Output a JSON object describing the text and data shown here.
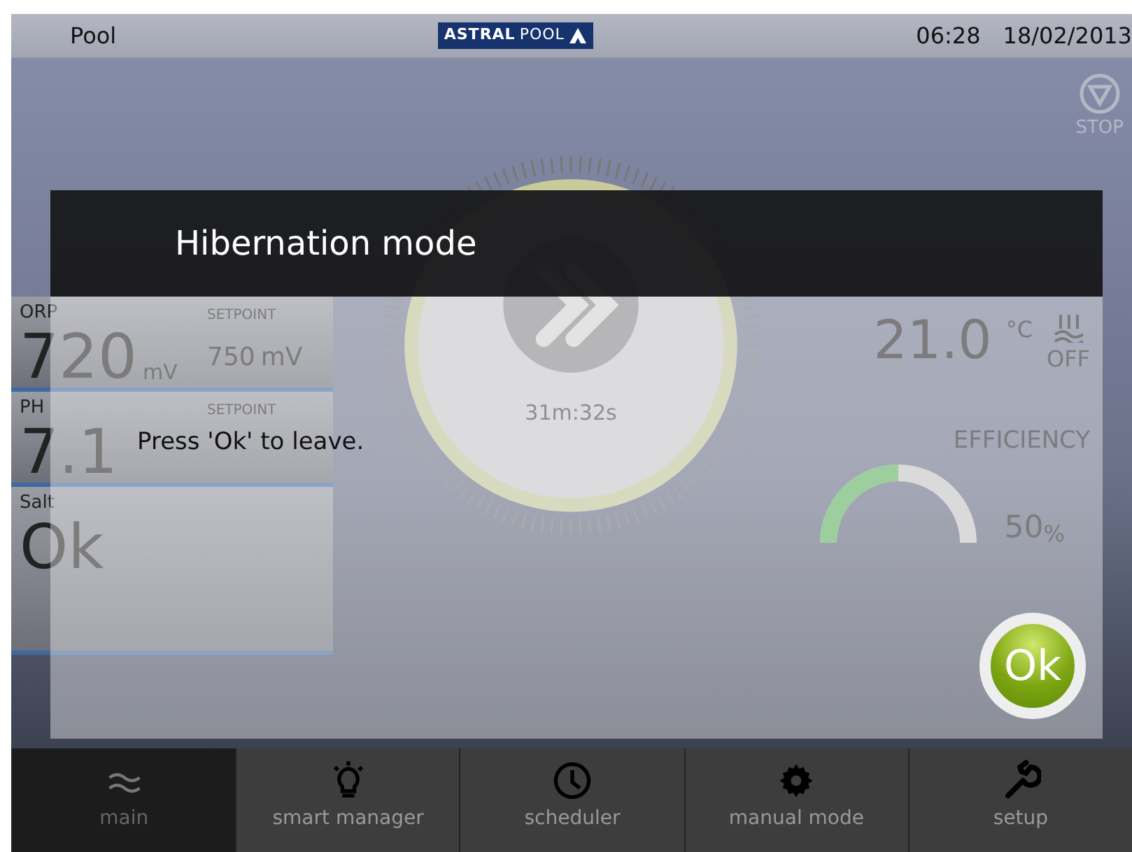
{
  "status_bar": {
    "title": "Pool",
    "logo": {
      "bold": "ASTRAL",
      "light": "POOL"
    },
    "time": "06:28",
    "date": "18/02/2013"
  },
  "stop_button": {
    "label": "STOP"
  },
  "readings": [
    {
      "label": "ORP",
      "value": "720",
      "unit": "mV",
      "setpoint": "750",
      "setpoint_unit": "mV",
      "setpoint_label": "SETPOINT"
    },
    {
      "label": "PH",
      "value": "7.1",
      "setpoint_label": "SETPOINT"
    },
    {
      "label": "Salt",
      "value": "Ok"
    }
  ],
  "dial": {
    "time": "31m:32s"
  },
  "temperature": {
    "value": "21.0",
    "unit": "°C"
  },
  "heating": {
    "state": "OFF"
  },
  "efficiency": {
    "label": "EFFICIENCY",
    "value": "50",
    "unit": "%",
    "level": 0.5
  },
  "modal": {
    "title": "Hibernation mode",
    "message": "Press 'Ok' to leave.",
    "ok_button": "Ok"
  },
  "tabs": [
    {
      "label": "main",
      "selected": true
    },
    {
      "label": "smart manager",
      "selected": false
    },
    {
      "label": "scheduler",
      "selected": false
    },
    {
      "label": "manual mode",
      "selected": false
    },
    {
      "label": "setup",
      "selected": false
    }
  ]
}
